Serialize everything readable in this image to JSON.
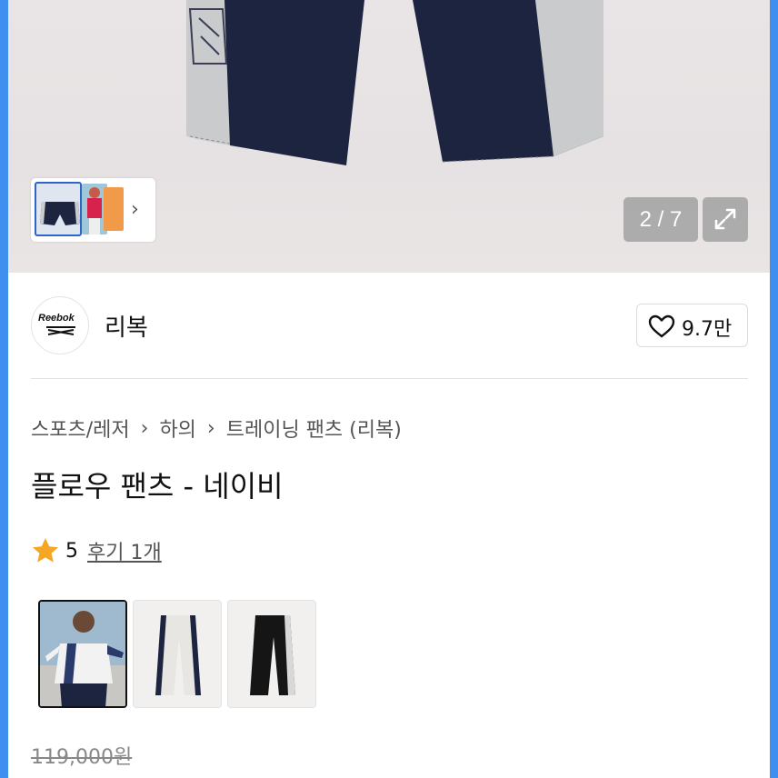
{
  "gallery": {
    "counter": "2 / 7",
    "colors": {
      "navy": "#1d2440",
      "grey": "#c9cbcc",
      "background": "#e8e4e5"
    }
  },
  "brand": {
    "logo_text": "Reebok",
    "name": "리복"
  },
  "like": {
    "count": "9.7만"
  },
  "breadcrumb": {
    "items": [
      "스포츠/레저",
      "하의",
      "트레이닝 팬츠 (리복)"
    ]
  },
  "product": {
    "title": "플로우 팬츠 - 네이비",
    "rating": "5",
    "review_link": "후기 1개",
    "original_price": "119,000원"
  },
  "icons": {
    "star": "star-icon",
    "heart": "heart-icon",
    "expand": "expand-icon",
    "chevron": "chevron-right-icon"
  },
  "accent": {
    "star": "#f5a623"
  }
}
